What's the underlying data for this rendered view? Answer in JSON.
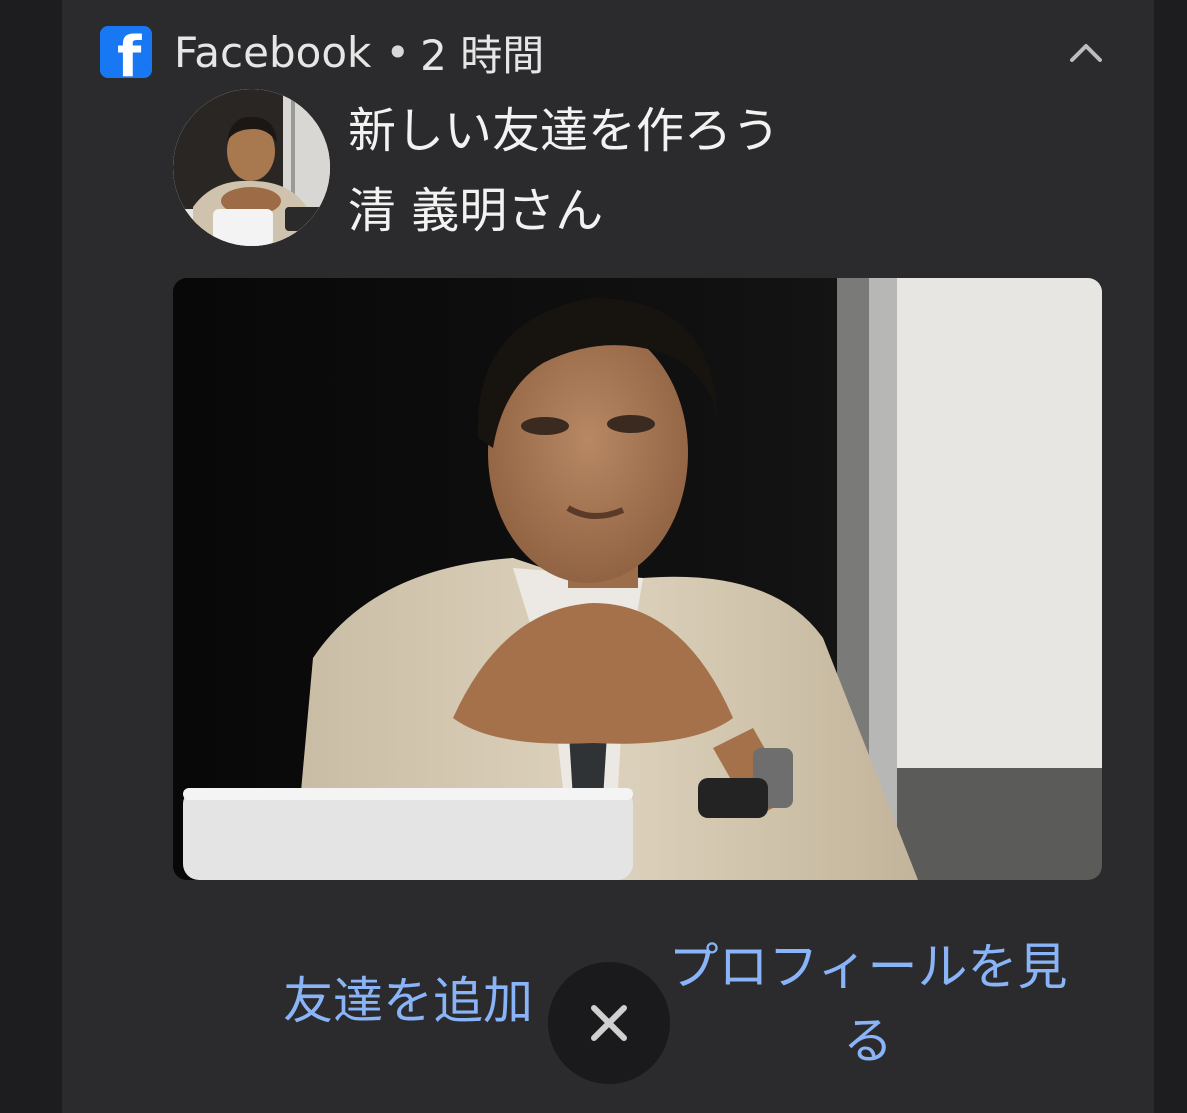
{
  "notification": {
    "app_name": "Facebook",
    "separator": "•",
    "time": "2 時間",
    "title": "新しい友達を作ろう",
    "subtitle": "清 義明さん",
    "icons": {
      "app": "facebook-icon",
      "collapse": "chevron-up-icon",
      "dismiss": "close-icon"
    }
  },
  "actions": {
    "add_friend": "友達を追加",
    "view_profile": "プロフィールを見る"
  },
  "colors": {
    "background": "#1d1d1f",
    "card": "#2b2b2d",
    "accent": "#8ab4f8",
    "facebook_blue": "#1877f2",
    "text": "#f2f2f2"
  }
}
